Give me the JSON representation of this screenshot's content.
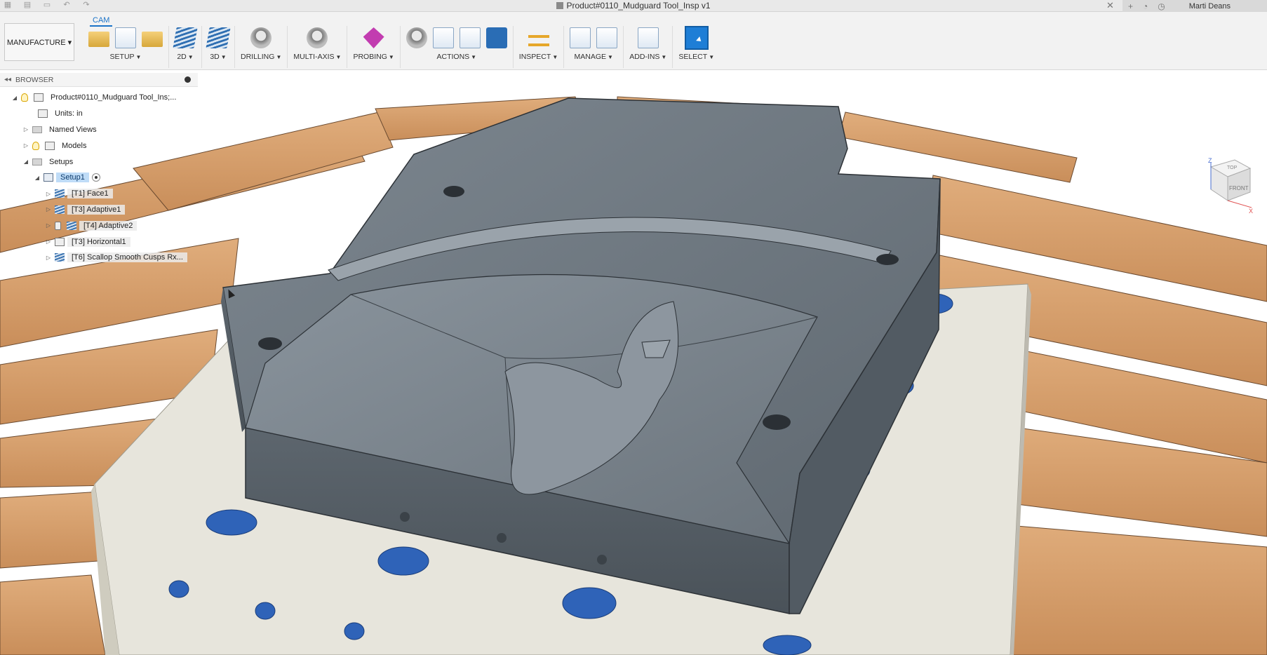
{
  "window": {
    "title": "Product#0110_Mudguard Tool_Insp v1",
    "user": "Marti Deans"
  },
  "ribbon": {
    "active_tab": "CAM",
    "workspace": "MANUFACTURE ▾",
    "groups": {
      "setup": "SETUP",
      "g2d": "2D",
      "g3d": "3D",
      "drilling": "DRILLING",
      "multiaxis": "MULTI-AXIS",
      "probing": "PROBING",
      "actions": "ACTIONS",
      "inspect": "INSPECT",
      "manage": "MANAGE",
      "addins": "ADD-INS",
      "select": "SELECT"
    }
  },
  "browser": {
    "title": "BROWSER",
    "root": "Product#0110_Mudguard Tool_Ins;...",
    "units": "Units: in",
    "named_views": "Named Views",
    "models": "Models",
    "setups": "Setups",
    "setup1": "Setup1",
    "operations": [
      "[T1] Face1",
      "[T3] Adaptive1",
      "[T4] Adaptive2",
      "[T3] Horizontal1",
      "[T6] Scallop Smooth Cusps Rx..."
    ]
  },
  "viewcube": {
    "top": "TOP",
    "front": "FRONT",
    "axis_z": "Z",
    "axis_x": "X"
  },
  "colors": {
    "fixture_wood": "#d39a68",
    "part_steel": "#6f7982",
    "base_plate": "#e7e5dc",
    "clamp_blue": "#2f63b8",
    "accent": "#1a73c8"
  }
}
